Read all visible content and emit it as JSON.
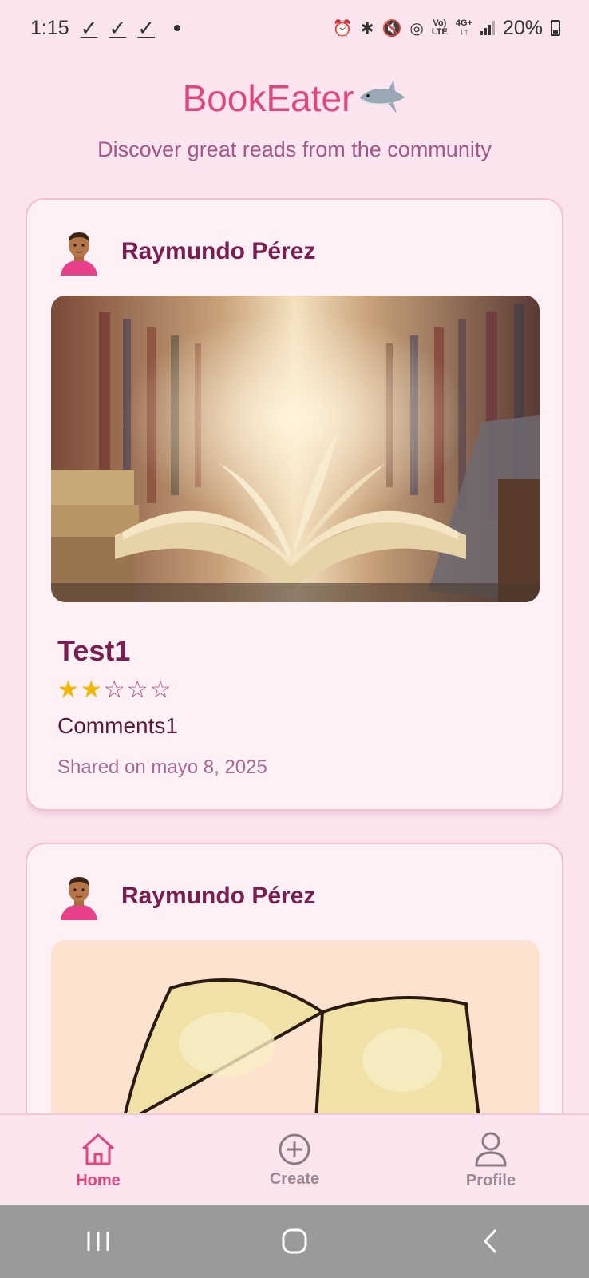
{
  "status_bar": {
    "time": "1:15",
    "battery": "20%",
    "network_top": "Vo)",
    "network_bottom": "LTE",
    "gen": "4G+"
  },
  "header": {
    "title": "BookEater",
    "subtitle": "Discover great reads from the community"
  },
  "posts": [
    {
      "user": "Raymundo Pérez",
      "title": "Test1",
      "rating": 2,
      "max_rating": 5,
      "stars_filled": "★★",
      "stars_empty": "☆☆☆",
      "comment": "Comments1",
      "shared": "Shared on mayo 8, 2025"
    },
    {
      "user": "Raymundo Pérez"
    }
  ],
  "bottom_nav": {
    "items": [
      {
        "label": "Home",
        "icon": "home-icon",
        "active": true
      },
      {
        "label": "Create",
        "icon": "plus-circle-icon",
        "active": false
      },
      {
        "label": "Profile",
        "icon": "user-icon",
        "active": false
      }
    ]
  },
  "colors": {
    "accent": "#e0457e",
    "background": "#fae4ee",
    "card": "#fdf1f6",
    "title_text": "#7a1d4f",
    "star": "#f2b705"
  }
}
